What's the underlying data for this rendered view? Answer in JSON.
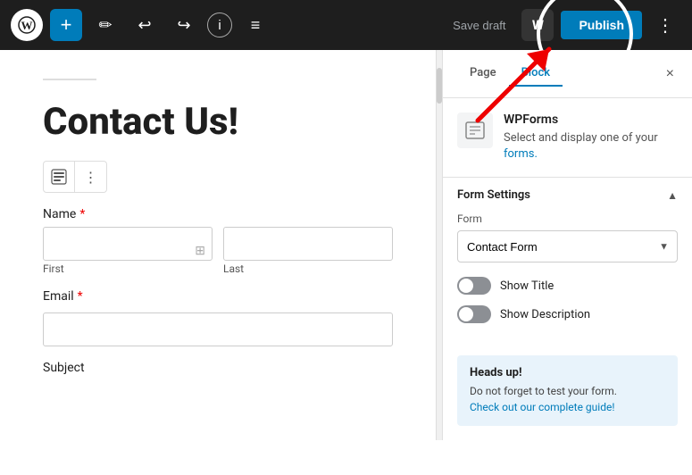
{
  "toolbar": {
    "wp_logo": "W",
    "add_label": "+",
    "pencil_icon": "✏",
    "undo_icon": "↩",
    "redo_icon": "↪",
    "info_icon": "ⓘ",
    "list_icon": "≡",
    "save_draft": "Save draft",
    "w_label": "W",
    "publish_label": "Publish",
    "more_icon": "⋮"
  },
  "editor": {
    "title": "Contact Us!",
    "name_label": "Name",
    "name_required": "*",
    "first_label": "First",
    "last_label": "Last",
    "email_label": "Email",
    "email_required": "*",
    "subject_label": "Subject"
  },
  "sidebar": {
    "tab_block": "Block",
    "tab_page": "Page",
    "close_label": "×",
    "wpforms_title": "WPForms",
    "wpforms_desc": "Select and display one of your forms.",
    "form_settings_title": "Form Settings",
    "form_label": "Form",
    "form_selected": "Contact Form",
    "show_title_label": "Show Title",
    "show_description_label": "Show Description",
    "headsup_title": "Heads up!",
    "headsup_text": "Do not forget to test your form.",
    "headsup_link": "Check out our complete guide!"
  }
}
